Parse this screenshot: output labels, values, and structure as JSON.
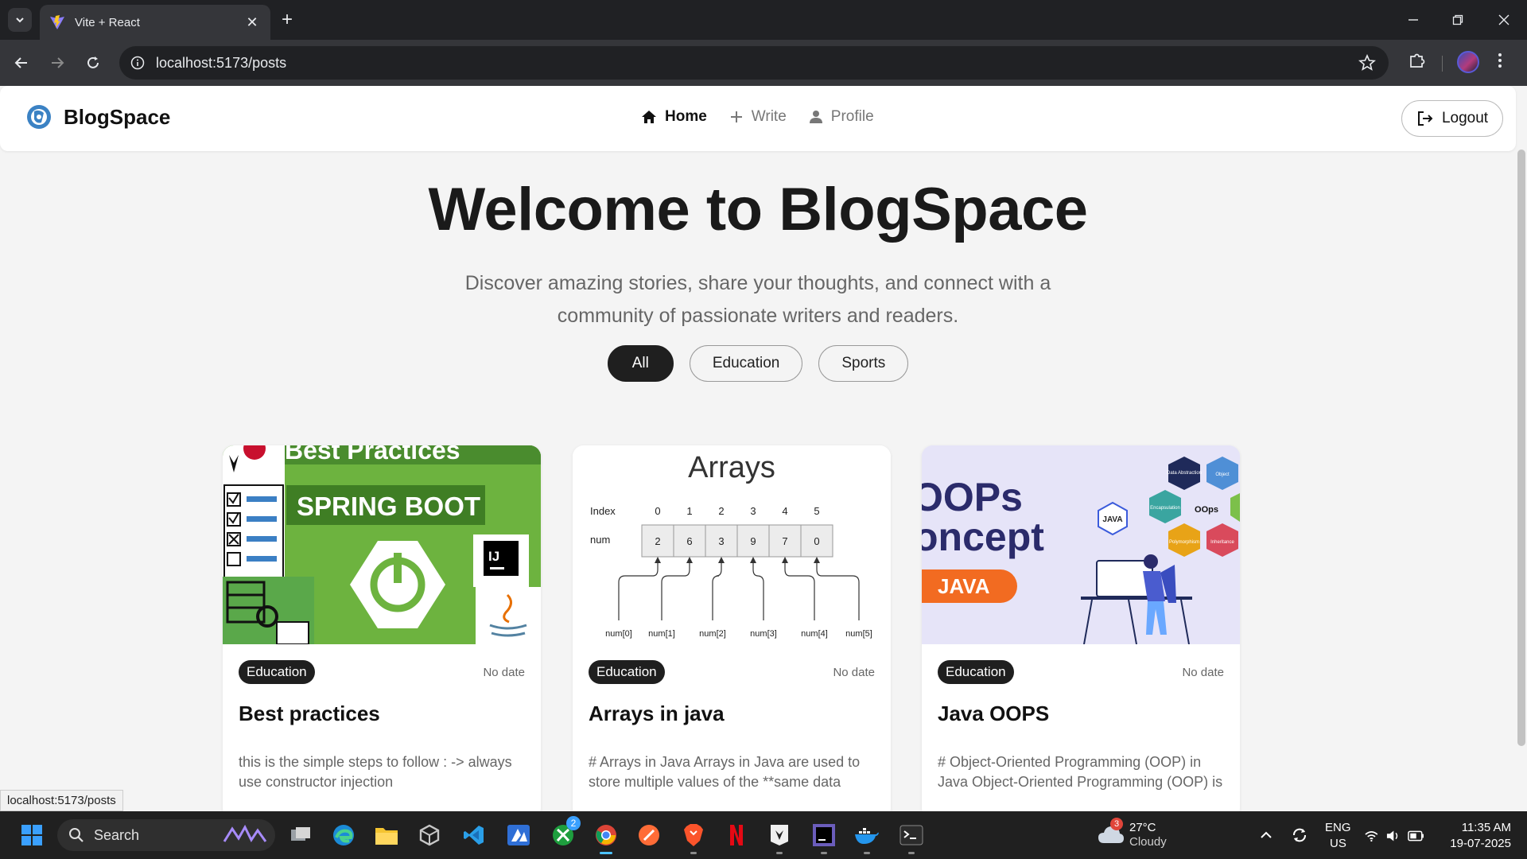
{
  "browser": {
    "tab_title": "Vite + React",
    "url": "localhost:5173/posts",
    "status_url": "localhost:5173/posts"
  },
  "site": {
    "brand": "BlogSpace",
    "nav": [
      {
        "label": "Home",
        "icon": "home-icon",
        "active": true
      },
      {
        "label": "Write",
        "icon": "plus-icon",
        "active": false
      },
      {
        "label": "Profile",
        "icon": "user-icon",
        "active": false
      }
    ],
    "logout_label": "Logout"
  },
  "hero": {
    "title": "Welcome to BlogSpace",
    "subtitle": "Discover amazing stories, share your thoughts, and connect with a community of passionate writers and readers."
  },
  "filters": [
    {
      "label": "All",
      "active": true
    },
    {
      "label": "Education",
      "active": false
    },
    {
      "label": "Sports",
      "active": false
    }
  ],
  "posts": [
    {
      "category": "Education",
      "date": "No date",
      "title": "Best practices",
      "excerpt": "this is the simple steps to follow : -> always use constructor injection",
      "image": {
        "heading": "Best Practices",
        "banner": "SPRING BOOT",
        "badge": "IJ"
      }
    },
    {
      "category": "Education",
      "date": "No date",
      "title": "Arrays in java",
      "excerpt": "# Arrays in Java Arrays in Java are used to store multiple values of the **same data",
      "image": {
        "heading": "Arrays",
        "index_label": "Index",
        "num_label": "num",
        "indices": [
          "0",
          "1",
          "2",
          "3",
          "4",
          "5"
        ],
        "values": [
          "2",
          "6",
          "3",
          "9",
          "7",
          "0"
        ],
        "refs": [
          "num[0]",
          "num[1]",
          "num[2]",
          "num[3]",
          "num[4]",
          "num[5]"
        ]
      }
    },
    {
      "category": "Education",
      "date": "No date",
      "title": "Java OOPS",
      "excerpt": "# Object-Oriented Programming (OOP) in Java Object-Oriented Programming (OOP) is",
      "image": {
        "line1": "OOPs",
        "line2": "oncept",
        "pill": "JAVA",
        "java_hex": "JAVA",
        "hexes": [
          "Data Abstraction",
          "Object",
          "Encapsulation",
          "OOps",
          "Polymorphism",
          "Inheritance"
        ]
      }
    }
  ],
  "taskbar": {
    "search_label": "Search",
    "weather_temp": "27°C",
    "weather_desc": "Cloudy",
    "weather_badge": "3",
    "xbox_badge": "2",
    "lang_line1": "ENG",
    "lang_line2": "US",
    "time": "11:35 AM",
    "date": "19-07-2025"
  },
  "colors": {
    "accent_dark": "#1f1f1f",
    "brand_blue": "#3b82c4",
    "spring_green": "#6db33f",
    "oop_bg": "#e6e4f8",
    "java_orange": "#f26b21"
  }
}
